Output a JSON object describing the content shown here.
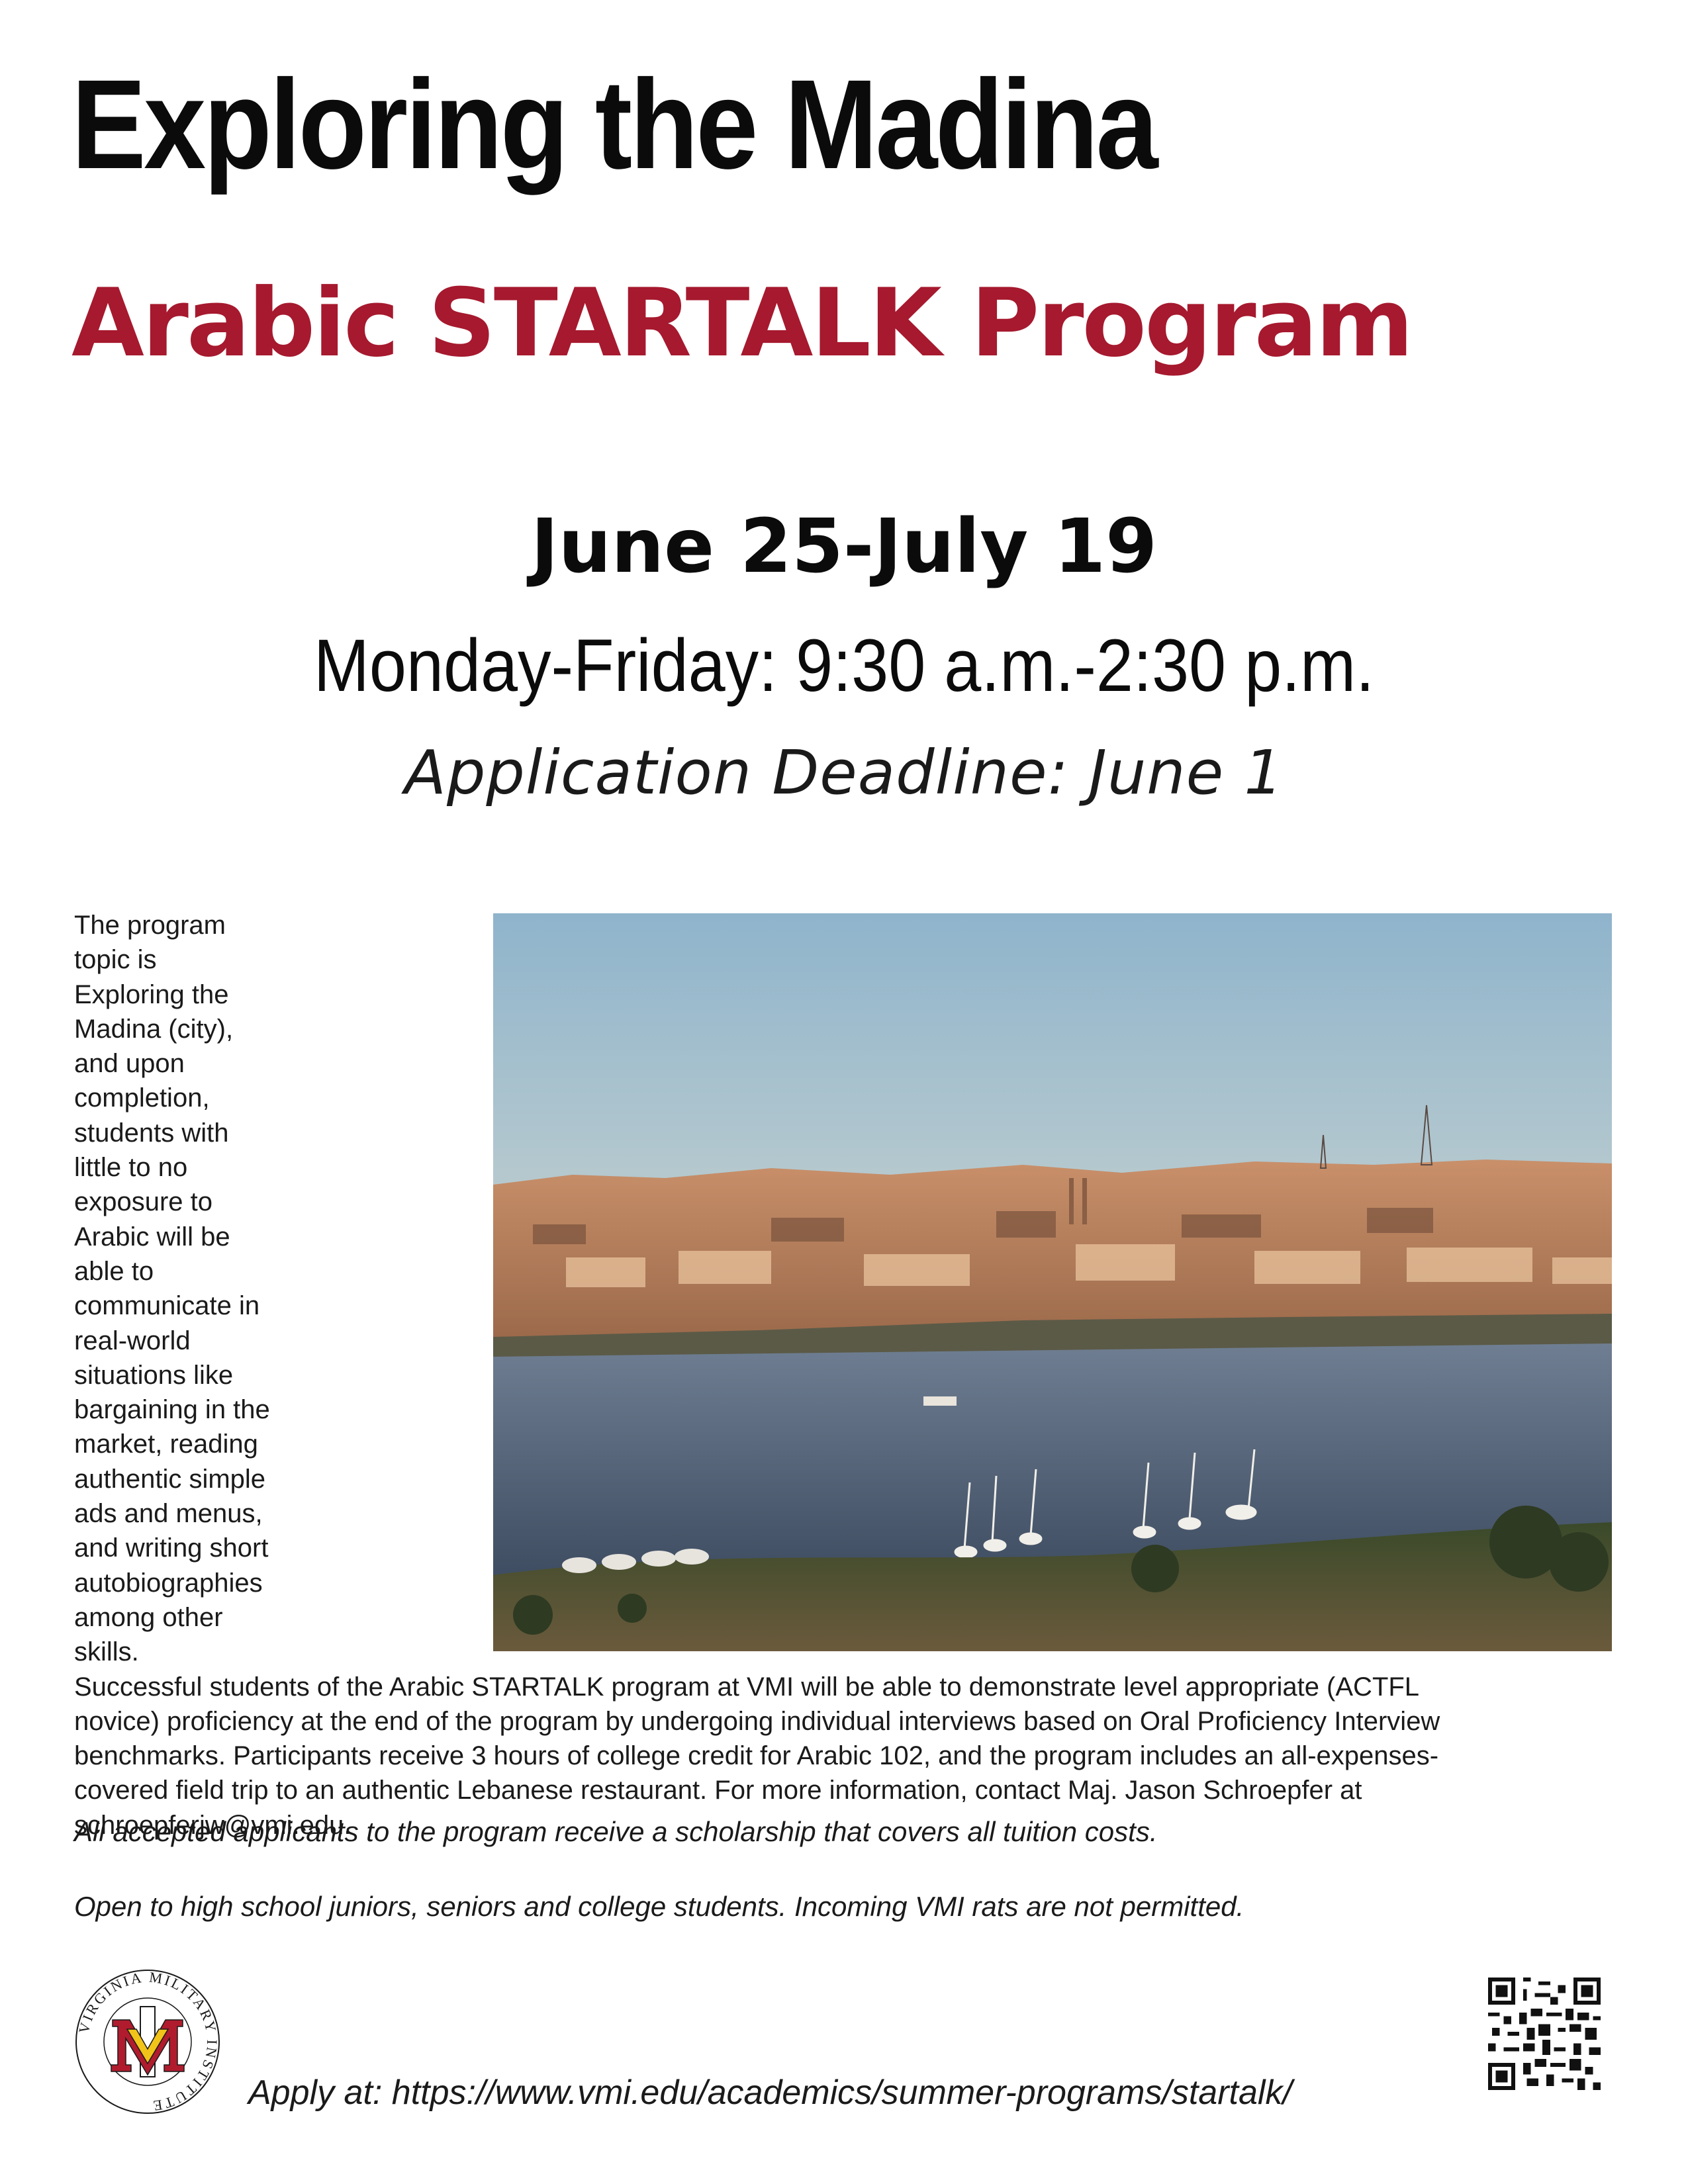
{
  "flyer": {
    "title": "Exploring the Madina",
    "subtitle": "Arabic STARTALK Program",
    "dates": "June 25-July 19",
    "hours": "Monday-Friday: 9:30 a.m.-2:30 p.m.",
    "deadline": "Application Deadline: June 1",
    "description": "The program topic is Exploring the Madina (city), and upon completion, students with little to no exposure to Arabic will be able to communicate in real-world situations like bargaining in the market, reading authentic simple ads and menus, and writing short autobiographies among other skills. Successful students of the Arabic STARTALK program at VMI will be able to demonstrate level appropriate (ACTFL novice) proficiency at the end of the program by undergoing individual interviews based on Oral Proficiency Interview benchmarks. Participants receive 3 hours of college credit for Arabic 102, and the program includes an all-expenses-covered field trip to an authentic Lebanese restaurant. For more information, contact Maj. Jason Schroepfer at schroepferjw@vmi.edu.",
    "scholarship_note": "All accepted applicants to the program receive a scholarship that covers all tuition costs.",
    "eligibility_note": "Open to high school juniors, seniors and college students. Incoming VMI rats are not permitted.",
    "apply_text": "Apply at: https://www.vmi.edu/academics/summer-programs/startalk/"
  },
  "logo": {
    "ring_text": "VIRGINIA MILITARY INSTITUTE",
    "colors": {
      "red": "#b01c2e",
      "yellow": "#f2c318"
    }
  },
  "colors": {
    "accent": "#a6192e",
    "text": "#0b0b0b"
  }
}
